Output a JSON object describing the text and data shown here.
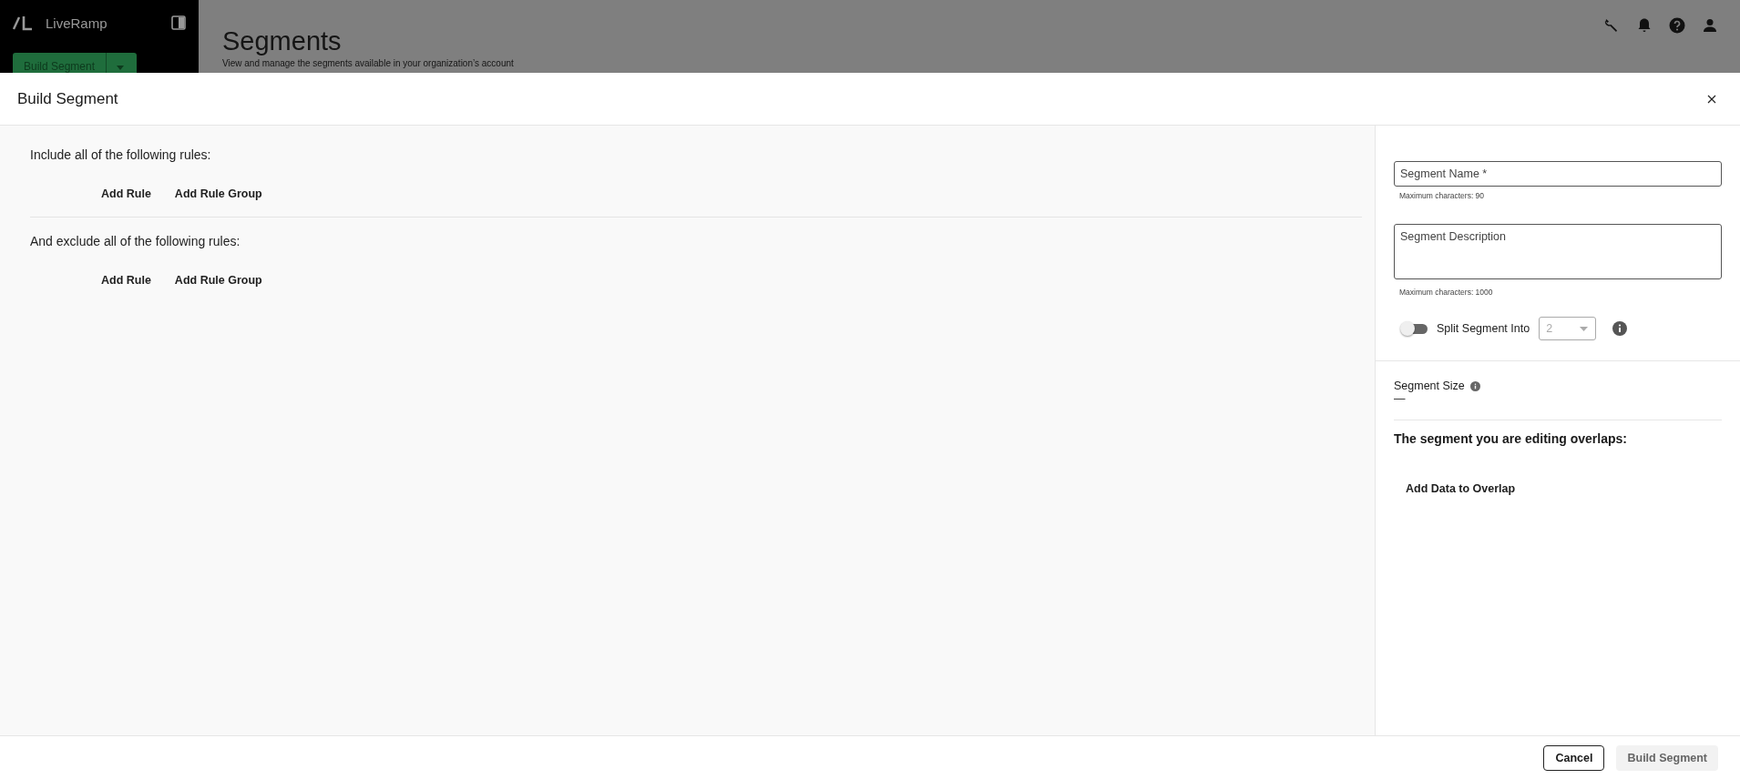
{
  "app": {
    "brand": "LiveRamp",
    "primary_action": "Build Segment",
    "page_title": "Segments",
    "page_subtitle": "View and manage the segments available in your organization’s account"
  },
  "modal": {
    "title": "Build Segment",
    "rule_sections": [
      {
        "heading": "Include all of the following rules:",
        "actions": [
          "Add Rule",
          "Add Rule Group"
        ]
      },
      {
        "heading": "And exclude all of the following rules:",
        "actions": [
          "Add Rule",
          "Add Rule Group"
        ]
      }
    ],
    "name_field": {
      "placeholder": "Segment Name *",
      "hint": "Maximum characters: 90"
    },
    "description_field": {
      "placeholder": "Segment Description",
      "hint": "Maximum characters: 1000"
    },
    "split": {
      "label": "Split Segment Into",
      "on": false,
      "value": "2",
      "disabled": true
    },
    "size": {
      "label": "Segment Size",
      "value": "—"
    },
    "overlap": {
      "heading": "The segment you are editing overlaps:",
      "action": "Add Data to Overlap"
    },
    "footer": {
      "cancel": "Cancel",
      "submit": {
        "label": "Build Segment",
        "disabled": true
      }
    }
  }
}
